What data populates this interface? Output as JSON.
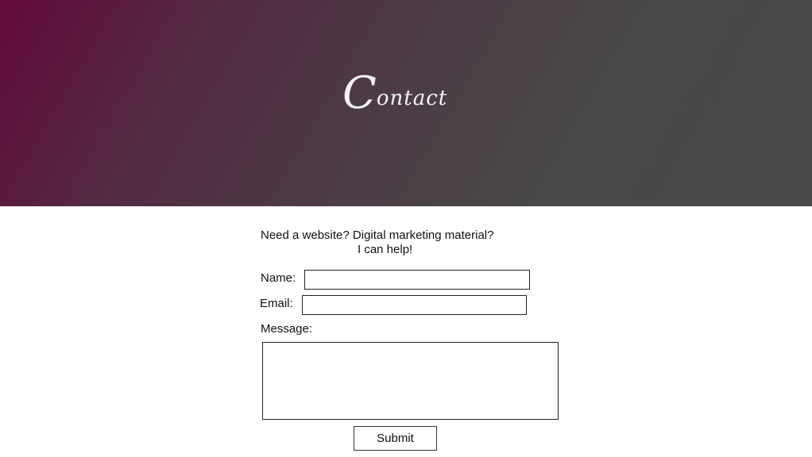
{
  "hero": {
    "title_initial": "C",
    "title_rest": "ontact"
  },
  "intro": {
    "line1": "Need a website? Digital marketing material?",
    "line2": "I can help!"
  },
  "form": {
    "name_label": "Name:",
    "name_value": "",
    "email_label": "Email:",
    "email_value": "",
    "message_label": "Message:",
    "message_value": "",
    "submit_label": "Submit"
  },
  "colors": {
    "gradient_start": "#620a3a",
    "gradient_end": "#484848",
    "title_text": "#f4f4f4"
  }
}
